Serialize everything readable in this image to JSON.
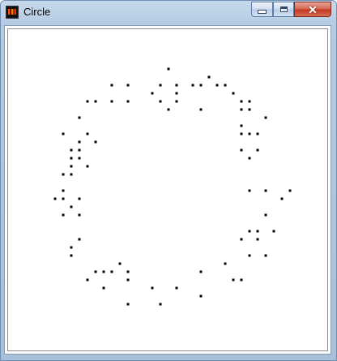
{
  "window": {
    "title": "Circle",
    "icon": "app-icon",
    "controls": {
      "minimize_icon": "minimize-icon",
      "maximize_icon": "maximize-icon",
      "close_icon": "close-icon",
      "close_glyph": "✕"
    }
  },
  "chart_data": {
    "type": "scatter",
    "title": "",
    "xlabel": "",
    "ylabel": "",
    "grid": false,
    "points": [
      [
        206,
        83
      ],
      [
        256,
        93
      ],
      [
        136,
        103
      ],
      [
        156,
        103
      ],
      [
        196,
        103
      ],
      [
        216,
        103
      ],
      [
        236,
        103
      ],
      [
        246,
        103
      ],
      [
        266,
        103
      ],
      [
        276,
        103
      ],
      [
        186,
        113
      ],
      [
        216,
        113
      ],
      [
        286,
        113
      ],
      [
        106,
        123
      ],
      [
        116,
        123
      ],
      [
        136,
        123
      ],
      [
        156,
        123
      ],
      [
        196,
        123
      ],
      [
        216,
        123
      ],
      [
        296,
        123
      ],
      [
        306,
        123
      ],
      [
        206,
        133
      ],
      [
        246,
        133
      ],
      [
        296,
        133
      ],
      [
        306,
        133
      ],
      [
        96,
        143
      ],
      [
        326,
        143
      ],
      [
        296,
        153
      ],
      [
        76,
        163
      ],
      [
        106,
        163
      ],
      [
        296,
        163
      ],
      [
        306,
        163
      ],
      [
        316,
        163
      ],
      [
        96,
        173
      ],
      [
        116,
        173
      ],
      [
        86,
        183
      ],
      [
        96,
        183
      ],
      [
        296,
        183
      ],
      [
        316,
        183
      ],
      [
        86,
        193
      ],
      [
        96,
        193
      ],
      [
        306,
        193
      ],
      [
        86,
        203
      ],
      [
        106,
        203
      ],
      [
        76,
        213
      ],
      [
        86,
        213
      ],
      [
        76,
        233
      ],
      [
        306,
        233
      ],
      [
        326,
        233
      ],
      [
        356,
        233
      ],
      [
        66,
        243
      ],
      [
        76,
        243
      ],
      [
        96,
        243
      ],
      [
        346,
        243
      ],
      [
        86,
        253
      ],
      [
        76,
        263
      ],
      [
        96,
        263
      ],
      [
        326,
        263
      ],
      [
        306,
        283
      ],
      [
        316,
        283
      ],
      [
        336,
        283
      ],
      [
        96,
        293
      ],
      [
        296,
        293
      ],
      [
        316,
        293
      ],
      [
        86,
        303
      ],
      [
        86,
        313
      ],
      [
        306,
        313
      ],
      [
        326,
        313
      ],
      [
        146,
        323
      ],
      [
        276,
        323
      ],
      [
        116,
        333
      ],
      [
        126,
        333
      ],
      [
        136,
        333
      ],
      [
        156,
        333
      ],
      [
        246,
        333
      ],
      [
        106,
        343
      ],
      [
        156,
        343
      ],
      [
        286,
        343
      ],
      [
        296,
        343
      ],
      [
        126,
        353
      ],
      [
        186,
        353
      ],
      [
        216,
        353
      ],
      [
        246,
        363
      ],
      [
        156,
        373
      ],
      [
        196,
        373
      ]
    ]
  }
}
